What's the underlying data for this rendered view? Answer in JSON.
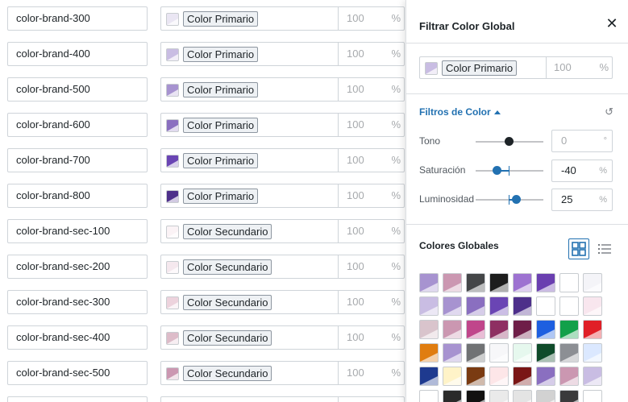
{
  "rows": [
    {
      "name": "color-brand-300",
      "tag": "Color Primario",
      "swatch": "#eae6f3",
      "opacity": "100",
      "unit": "%"
    },
    {
      "name": "color-brand-400",
      "tag": "Color Primario",
      "swatch": "#c9bde3",
      "opacity": "100",
      "unit": "%"
    },
    {
      "name": "color-brand-500",
      "tag": "Color Primario",
      "swatch": "#a793d0",
      "opacity": "100",
      "unit": "%"
    },
    {
      "name": "color-brand-600",
      "tag": "Color Primario",
      "swatch": "#8a6fc0",
      "opacity": "100",
      "unit": "%"
    },
    {
      "name": "color-brand-700",
      "tag": "Color Primario",
      "swatch": "#6a45b4",
      "opacity": "100",
      "unit": "%"
    },
    {
      "name": "color-brand-800",
      "tag": "Color Primario",
      "swatch": "#4d2f8a",
      "opacity": "100",
      "unit": "%"
    },
    {
      "name": "color-brand-sec-100",
      "tag": "Color Secundario",
      "swatch": "#fbf3f6",
      "opacity": "100",
      "unit": "%"
    },
    {
      "name": "color-brand-sec-200",
      "tag": "Color Secundario",
      "swatch": "#f5e8ee",
      "opacity": "100",
      "unit": "%"
    },
    {
      "name": "color-brand-sec-300",
      "tag": "Color Secundario",
      "swatch": "#edd3dd",
      "opacity": "100",
      "unit": "%"
    },
    {
      "name": "color-brand-sec-400",
      "tag": "Color Secundario",
      "swatch": "#ddbcc9",
      "opacity": "100",
      "unit": "%"
    },
    {
      "name": "color-brand-sec-500",
      "tag": "Color Secundario",
      "swatch": "#cb97b1",
      "opacity": "100",
      "unit": "%"
    },
    {
      "name": "",
      "tag": "",
      "swatch": "#c08aa5",
      "opacity": "",
      "unit": ""
    }
  ],
  "panel": {
    "title": "Filtrar Color Global",
    "close_icon": "close-icon",
    "selected": {
      "tag": "Color Primario",
      "swatch": "#c9bde3",
      "opacity": "100",
      "unit": "%"
    },
    "filters_title": "Filtros de Color",
    "reset_icon": "reset-icon",
    "filters": [
      {
        "label": "Tono",
        "value": "0",
        "unit": "°",
        "placeholder": true
      },
      {
        "label": "Saturación",
        "value": "-40",
        "unit": "%",
        "placeholder": false
      },
      {
        "label": "Luminosidad",
        "value": "25",
        "unit": "%",
        "placeholder": false
      }
    ],
    "globals_title": "Colores Globales",
    "view_grid_icon": "grid-view-icon",
    "view_list_icon": "list-view-icon",
    "swatches": [
      [
        "#a793d0",
        "#cb97b1",
        "#444648",
        "#1d1d1d",
        "#9d72d1",
        "#6a3fb0",
        "#ffffff",
        "#f4f4f8"
      ],
      [
        "#c9bde3",
        "#a793d0",
        "#8a6fc0",
        "#6a45b4",
        "#4d2f8a",
        "#ffffff",
        "#ffffff",
        "#f8e6ee"
      ],
      [
        "#d9c4cc",
        "#cb97b1",
        "#c0468b",
        "#8e2f62",
        "#6e1e48",
        "#1e5fe0",
        "#12a04a",
        "#e01f27"
      ],
      [
        "#e07d10",
        "#a793d0",
        "#707274",
        "#f7f7f9",
        "#e6f8ee",
        "#0f4b2a",
        "#8c8f94",
        "#dbe8ff"
      ],
      [
        "#1e3a8f",
        "#fff3c8",
        "#7a3b12",
        "#fde6e8",
        "#7a1616",
        "#8a6fc0",
        "#cb97b1",
        "#c9bde3"
      ],
      [
        "#ffffff",
        "#2a2a2a",
        "#111111",
        "#eaeaea",
        "#e4e4e4",
        "#d2d2d2",
        "#3a3a3c",
        "#ffffff"
      ]
    ]
  }
}
